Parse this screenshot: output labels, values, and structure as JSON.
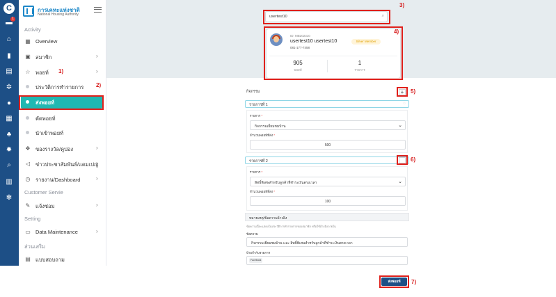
{
  "rail": {
    "logo": "C",
    "badge": "1",
    "icons": [
      "inbox-icon",
      "home-icon",
      "book-icon",
      "document-icon",
      "gear-icon",
      "user-icon",
      "grid-icon",
      "users-icon",
      "settings-icon",
      "search-icon",
      "chart-icon",
      "cog-icon"
    ]
  },
  "brand": {
    "name_th": "การเคหะแห่งชาติ",
    "name_en": "National Housing Authority"
  },
  "sidebar": {
    "sections": {
      "activity": "Activity",
      "customer_service": "Customer Servie",
      "setting": "Setting",
      "extra": "ส่วนเสริม"
    },
    "items": {
      "overview": "Overview",
      "members": "สมาชิก",
      "points": "พอยท์",
      "point_history": "ประวัติการทำรายการ",
      "send_points": "ส่งพอยท์",
      "deduct_points": "ตัดพอยท์",
      "import_points": "นำเข้าพอยท์",
      "rewards": "ของรางวัล/คูปอง",
      "news": "ข่าวประชาสัมพันธ์/แคมเปญ",
      "reports": "รายงาน/Dashboard",
      "repair": "แจ้งซ่อม",
      "data_maintenance": "Data Maintenance",
      "survey": "แบบสอบถาม"
    }
  },
  "annotations": [
    "1)",
    "2)",
    "3)",
    "4)",
    "5)",
    "6)",
    "7)"
  ],
  "search": {
    "value": "usertest10"
  },
  "member_card": {
    "id": "ID: MB202310",
    "name": "usertest10  usertest10",
    "phone": "081-177-7458",
    "tier": "Silver Member",
    "points_value": "905",
    "points_label": "พอยท์",
    "items_value": "1",
    "items_label": "รายการ"
  },
  "form": {
    "activity_label": "กิจกรรม",
    "add_symbol": "+",
    "entries": [
      {
        "title": "รายการที่ 1",
        "list_label": "รายการ",
        "list_value": "กิจกรรมเยี่ยมชมบ้าน",
        "points_label": "จำนวนพอยท์ที่ส่ง",
        "points_value": "500"
      },
      {
        "title": "รายการที่ 2",
        "list_label": "รายการ",
        "list_value": "สิทธิ์พิเศษสำหรับลูกค้าที่ชำระเงินตรงเวลา",
        "points_label": "จำนวนพอยท์ที่ส่ง",
        "points_value": "100"
      }
    ],
    "note_title": "หมายเหตุ/ข้อความอ้างอิง",
    "note_hint": "ข้อความนี้จะแสดงในประวัติการทำรายการของสมาชิก หรือใช้อ้างอิงภายใน",
    "message_label": "ข้อความ",
    "message_value": "กิจกรรมเยี่ยมชมบ้าน และ สิทธิ์พิเศษสำหรับลูกค้าที่ชำระเงินตรงเวลา",
    "tag_label": "ป้ายกำกับรายการ",
    "tag_value": "Facebook",
    "submit": "ส่งพอยท์"
  }
}
